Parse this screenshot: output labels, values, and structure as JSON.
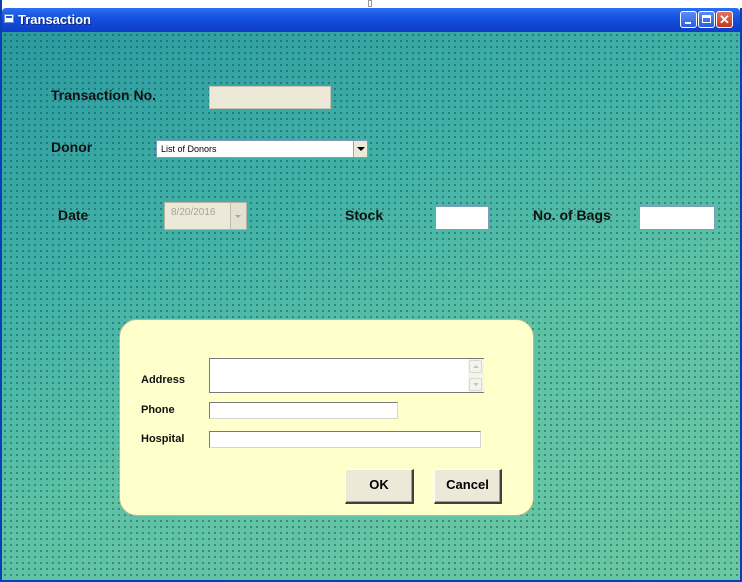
{
  "window": {
    "title": "Transaction"
  },
  "form": {
    "transaction_no_label": "Transaction No.",
    "donor_label": "Donor",
    "donor_selected": "List of Donors",
    "date_label": "Date",
    "date_value": "8/20/2016",
    "stock_label": "Stock",
    "bags_label": "No. of Bags"
  },
  "details": {
    "address_label": "Address",
    "phone_label": "Phone",
    "hospital_label": "Hospital",
    "ok_label": "OK",
    "cancel_label": "Cancel"
  },
  "colors": {
    "title_bar": "#1451e0",
    "panel_background": "#ffffcc",
    "form_background": "#3aa7a6"
  }
}
